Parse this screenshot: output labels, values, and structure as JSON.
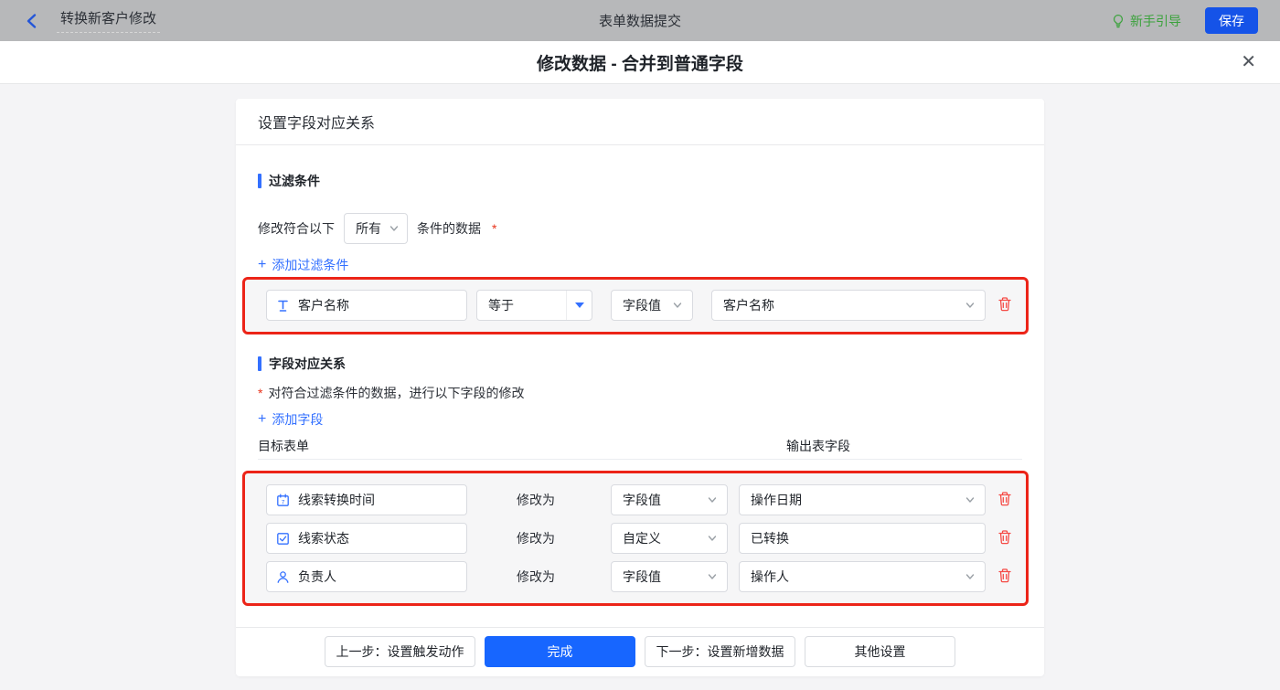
{
  "colors": {
    "accent_blue": "#3370ff",
    "save_blue": "#1553e8",
    "primary_blue": "#1766ff",
    "highlight_red": "#ec2418",
    "trash_red": "#f54a45",
    "guide_green": "#3ba23c",
    "topbar_gray": "#b7b8ba"
  },
  "icons": {
    "back": "chevron-left-icon",
    "guide": "lightbulb-icon",
    "close": "close-icon",
    "text_field": "text-field-icon",
    "date_field": "calendar-icon",
    "select_field": "checkbox-icon",
    "person_field": "person-icon",
    "delete": "trash-icon",
    "dropdown": "chevron-down-icon",
    "operator_caret": "triangle-down-icon"
  },
  "topbar": {
    "back_label": "转换新客户修改",
    "center_title": "表单数据提交",
    "guide_label": "新手引导",
    "save_label": "保存"
  },
  "modal": {
    "title": "修改数据 - 合并到普通字段",
    "close_glyph": "✕"
  },
  "card": {
    "header": "设置字段对应关系",
    "filter": {
      "title": "过滤条件",
      "match_prefix": "修改符合以下",
      "match_select_value": "所有",
      "match_suffix": "条件的数据",
      "required_mark": "*",
      "add_link": "添加过滤条件",
      "add_plus": "+",
      "condition": {
        "field": "客户名称",
        "operator": "等于",
        "value_type": "字段值",
        "value": "客户名称"
      }
    },
    "mapping": {
      "title": "字段对应关系",
      "required_mark": "*",
      "description": "对符合过滤条件的数据，进行以下字段的修改",
      "add_link": "添加字段",
      "add_plus": "+",
      "col_target": "目标表单",
      "col_output": "输出表字段",
      "modify_label": "修改为",
      "rows": [
        {
          "field": "线索转换时间",
          "type": "字段值",
          "value": "操作日期"
        },
        {
          "field": "线索状态",
          "type": "自定义",
          "value": "已转换"
        },
        {
          "field": "负责人",
          "type": "字段值",
          "value": "操作人"
        }
      ]
    },
    "footer": {
      "prev": "上一步：设置触发动作",
      "done": "完成",
      "next": "下一步：设置新增数据",
      "other": "其他设置"
    }
  }
}
